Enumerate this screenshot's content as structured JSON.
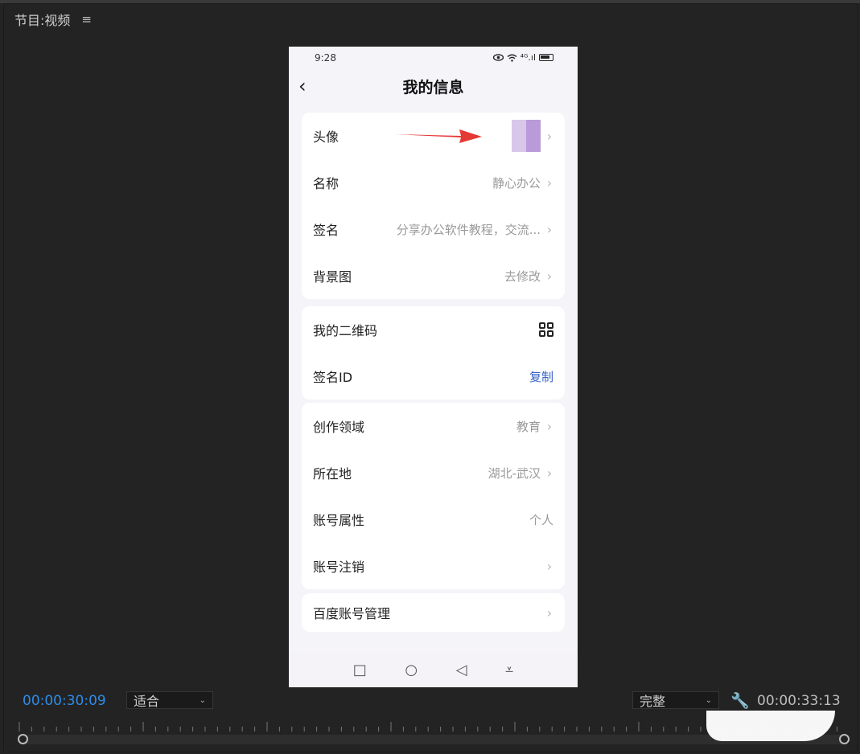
{
  "panel": {
    "title": "节目:视频",
    "menu_icon": "≡"
  },
  "phone": {
    "status_time": "9:28",
    "status_signal": "⁴ᴳ.ıl",
    "back_icon": "‹",
    "title": "我的信息",
    "sections": [
      [
        {
          "label": "头像",
          "value": ""
        },
        {
          "label": "名称",
          "value": "静心办公"
        },
        {
          "label": "签名",
          "value": "分享办公软件教程，交流..."
        },
        {
          "label": "背景图",
          "value": "去修改"
        }
      ],
      [
        {
          "label": "我的二维码",
          "value": ""
        },
        {
          "label": "签名ID",
          "value": "复制"
        }
      ],
      [
        {
          "label": "创作领域",
          "value": "教育"
        },
        {
          "label": "所在地",
          "value": "湖北-武汉"
        },
        {
          "label": "账号属性",
          "value": "个人"
        },
        {
          "label": "账号注销",
          "value": ""
        }
      ],
      [
        {
          "label": "百度账号管理",
          "value": ""
        }
      ]
    ],
    "chevron": "›",
    "sysnav": {
      "square": "□",
      "circle": "○",
      "back": "◁",
      "menu": "⩡"
    }
  },
  "controls": {
    "timecode_current": "00:00:30:09",
    "fit_label": "适合",
    "quality_label": "完整",
    "dropdown_icon": "⌄",
    "wrench_icon": "🔧",
    "timecode_total": "00:00:33:13"
  },
  "colors": {
    "accent": "#2d8ceb",
    "link": "#3763c6",
    "arrow": "#e53935"
  }
}
